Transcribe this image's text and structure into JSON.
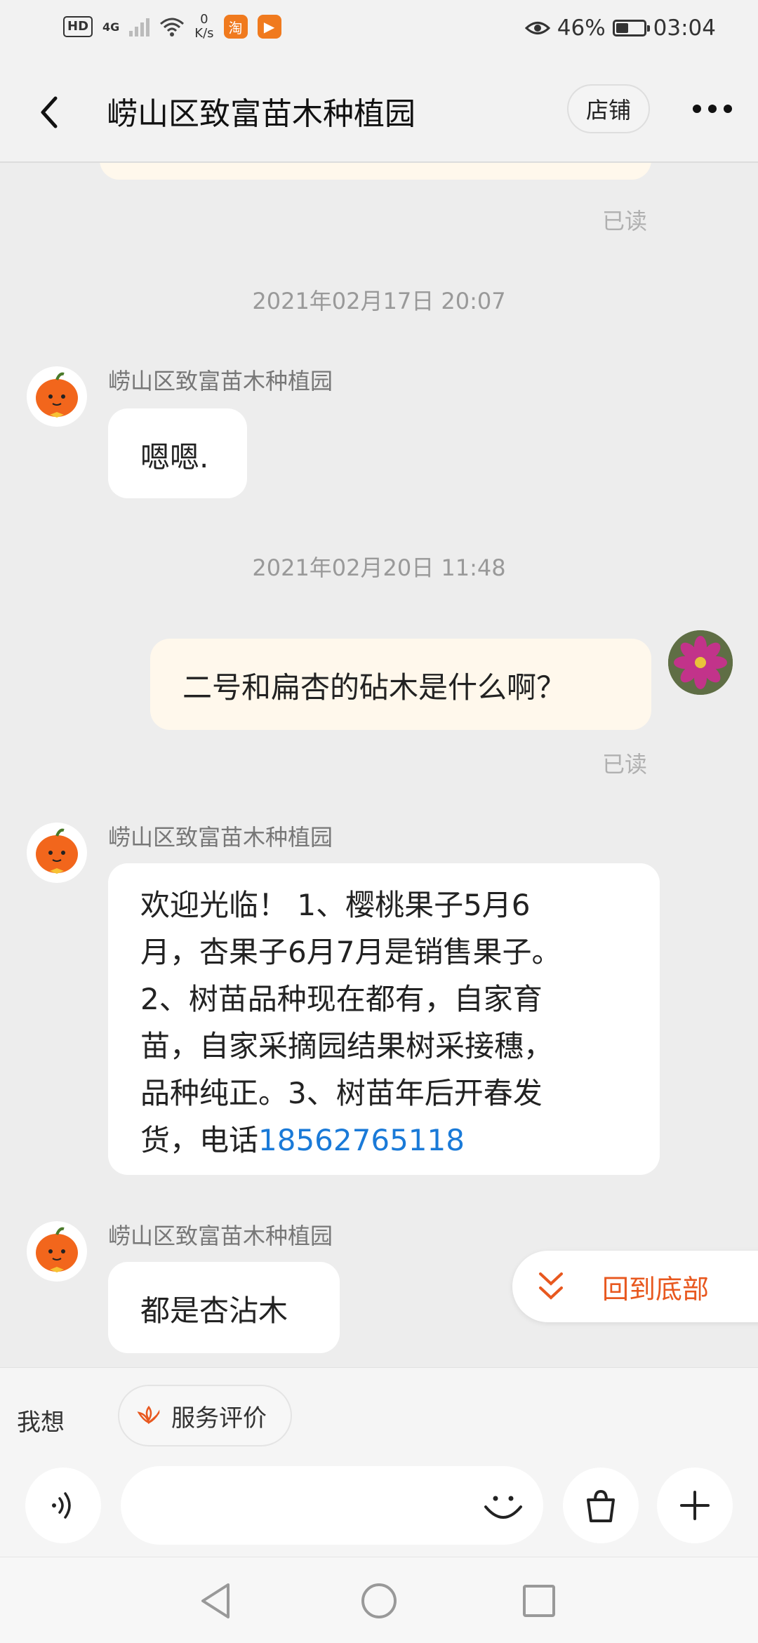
{
  "status_bar": {
    "hd": "HD",
    "network": "4G",
    "speed_value": "0",
    "speed_unit": "K/s",
    "battery_percent": "46%",
    "battery_level": 0.46,
    "time": "03:04"
  },
  "header": {
    "title": "崂山区致富苗木种植园",
    "shop_label": "店铺"
  },
  "chat": {
    "read_label_1": "已读",
    "timestamp_1": "2021年02月17日 20:07",
    "msg1_sender": "崂山区致富苗木种植园",
    "msg1_text": "嗯嗯.",
    "timestamp_2": "2021年02月20日 11:48",
    "msg2_text": "二号和扁杏的砧木是什么啊？",
    "read_label_2": "已读",
    "msg3_sender": "崂山区致富苗木种植园",
    "msg3_line1": "欢迎光临！ 1、樱桃果子5月6",
    "msg3_line2": "月，杏果子6月7月是销售果子。",
    "msg3_line3": "2、树苗品种现在都有，自家育",
    "msg3_line4": "苗，自家采摘园结果树采接穗，",
    "msg3_line5": "品种纯正。3、树苗年后开春发",
    "msg3_line6_prefix": "货，电话",
    "msg3_phone": "18562765118",
    "msg4_sender": "崂山区致富苗木种植园",
    "msg4_text": "都是杏沾木",
    "return_bottom_label": "回到底部"
  },
  "bottom": {
    "want_label": "我想",
    "service_chip_label": "服务评价",
    "input_placeholder": ""
  },
  "colors": {
    "accent_orange": "#e8581f",
    "link_blue": "#1a7ad8",
    "my_bubble": "#fff8ec"
  }
}
